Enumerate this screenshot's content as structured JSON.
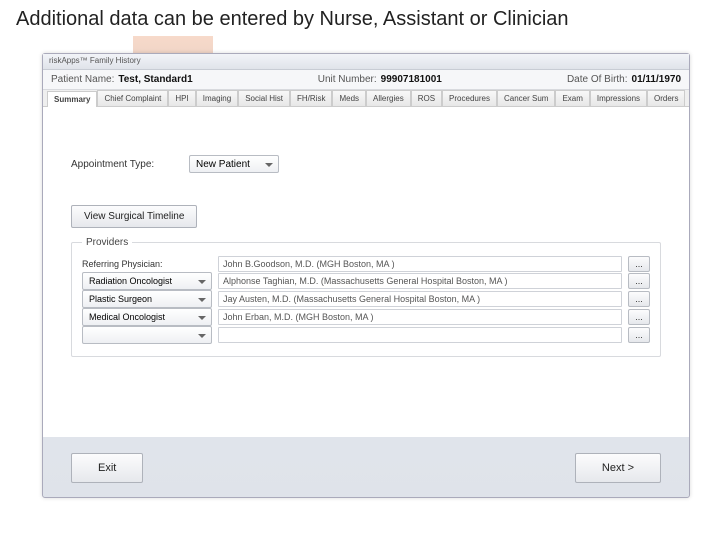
{
  "slide": {
    "title": "Additional data can be entered by Nurse, Assistant or Clinician"
  },
  "window": {
    "title": "riskApps™ Family History"
  },
  "patient": {
    "name_label": "Patient Name:",
    "name": "Test, Standard1",
    "unit_label": "Unit Number:",
    "unit": "99907181001",
    "dob_label": "Date Of Birth:",
    "dob": "01/11/1970"
  },
  "tabs": [
    "Summary",
    "Chief Complaint",
    "HPI",
    "Imaging",
    "Social Hist",
    "FH/Risk",
    "Meds",
    "Allergies",
    "ROS",
    "Procedures",
    "Cancer Sum",
    "Exam",
    "Impressions",
    "Orders"
  ],
  "active_tab_index": 0,
  "appt": {
    "label": "Appointment Type:",
    "value": "New Patient"
  },
  "timeline_btn": "View Surgical Timeline",
  "providers": {
    "legend": "Providers",
    "rows": [
      {
        "type_label": "Referring Physician:",
        "is_select": false,
        "name": "John B.Goodson, M.D.  (MGH Boston, MA )"
      },
      {
        "type_label": "Radiation Oncologist",
        "is_select": true,
        "name": "Alphonse Taghian, M.D. (Massachusetts General Hospital Boston, MA )"
      },
      {
        "type_label": "Plastic Surgeon",
        "is_select": true,
        "name": "Jay Austen, M.D. (Massachusetts General Hospital Boston, MA )"
      },
      {
        "type_label": "Medical Oncologist",
        "is_select": true,
        "name": "John Erban, M.D. (MGH Boston, MA )"
      },
      {
        "type_label": "",
        "is_select": true,
        "name": ""
      }
    ],
    "more_label": "..."
  },
  "footer": {
    "exit": "Exit",
    "next": "Next >"
  }
}
